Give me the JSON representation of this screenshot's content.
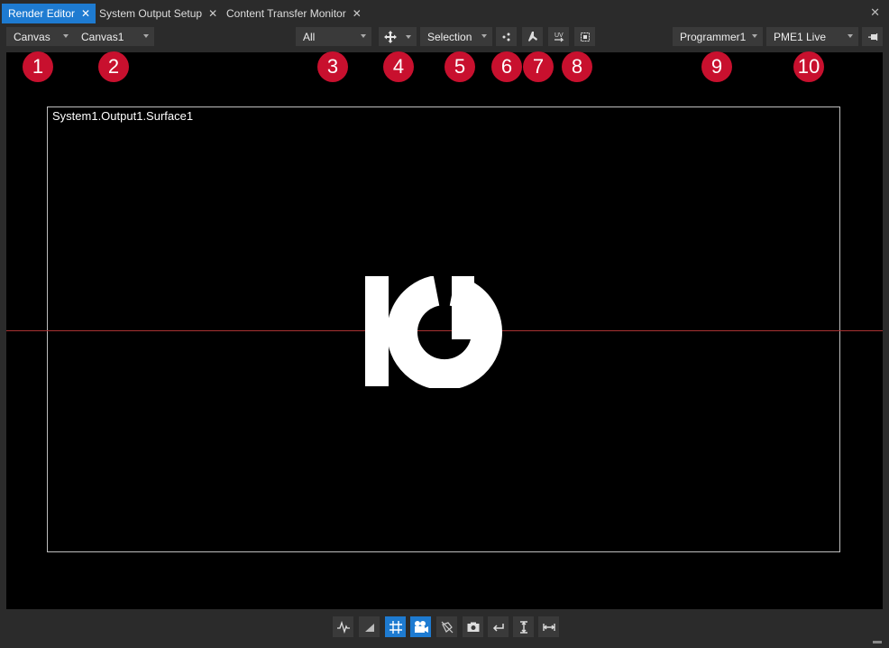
{
  "tabs": [
    {
      "label": "Render Editor",
      "active": true
    },
    {
      "label": "System Output Setup",
      "active": false
    },
    {
      "label": "Content Transfer Monitor",
      "active": false
    }
  ],
  "toolbar": {
    "view_mode": "Canvas",
    "canvas": "Canvas1",
    "filter": "All",
    "selection_mode": "Selection",
    "programmer": "Programmer1",
    "pme": "PME1 Live"
  },
  "badges": [
    "1",
    "2",
    "3",
    "4",
    "5",
    "6",
    "7",
    "8",
    "9",
    "10"
  ],
  "viewport": {
    "surface_label": "System1.Output1.Surface1"
  },
  "colors": {
    "accent": "#1e7bd1",
    "badge": "#c8102e",
    "guide_line": "#a83232"
  }
}
